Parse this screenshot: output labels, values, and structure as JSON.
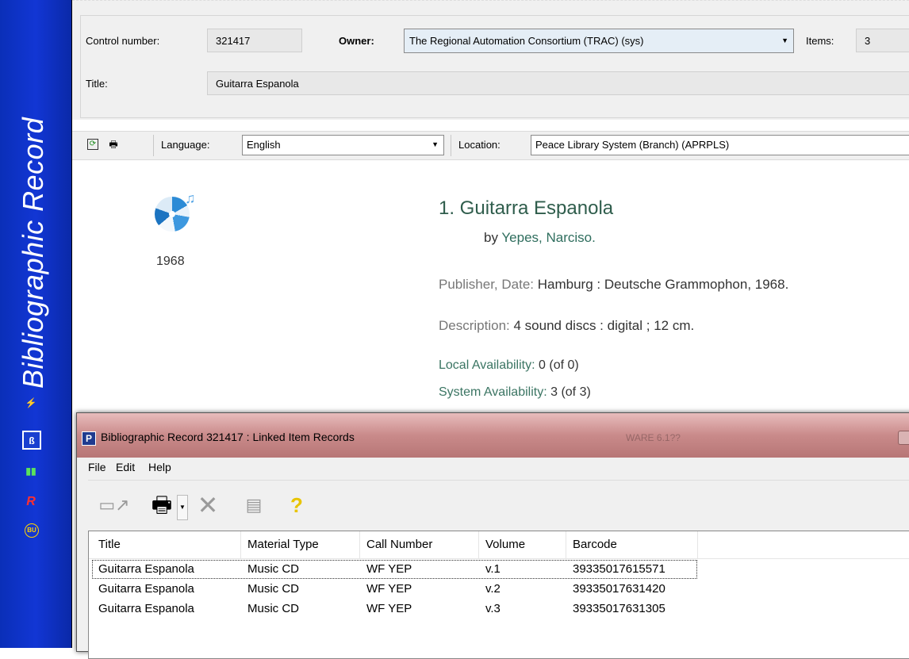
{
  "sidebar": {
    "title": "Bibliographic Record",
    "icons": [
      "lightning-icon",
      "bib-record-icon",
      "chart-icon",
      "r-logo-icon",
      "circle-logo-icon"
    ]
  },
  "header": {
    "control_number_label": "Control number:",
    "control_number": "321417",
    "owner_label": "Owner:",
    "owner": "The Regional Automation Consortium (TRAC) (sys)",
    "items_label": "Items:",
    "items": "3",
    "title_label": "Title:",
    "title": "Guitarra Espanola"
  },
  "toolbar": {
    "language_label": "Language:",
    "language": "English",
    "location_label": "Location:",
    "location": "Peace Library System (Branch) (APRPLS)"
  },
  "record": {
    "year": "1968",
    "title": "1. Guitarra Espanola",
    "by_label": "by",
    "author": "Yepes, Narciso.",
    "publisher_label": "Publisher, Date:",
    "publisher": "Hamburg : Deutsche Grammophon, 1968.",
    "description_label": "Description:",
    "description": "4 sound discs : digital ; 12 cm.",
    "local_label": "Local Availability:",
    "local": "0 (of 0)",
    "system_label": "System Availability:",
    "system": "3 (of 3)"
  },
  "window": {
    "logo": "P",
    "title": "Bibliographic Record 321417 : Linked Item Records",
    "ghost_text": "WARE 6.1??",
    "menu": [
      "File",
      "Edit",
      "Help"
    ],
    "columns": [
      "Title",
      "Material Type",
      "Call Number",
      "Volume",
      "Barcode"
    ],
    "rows": [
      [
        "Guitarra Espanola",
        "Music CD",
        "WF YEP",
        "v.1",
        "39335017615571"
      ],
      [
        "Guitarra Espanola",
        "Music CD",
        "WF YEP",
        "v.2",
        "39335017631420"
      ],
      [
        "Guitarra Espanola",
        "Music CD",
        "WF YEP",
        "v.3",
        "39335017631305"
      ]
    ]
  }
}
